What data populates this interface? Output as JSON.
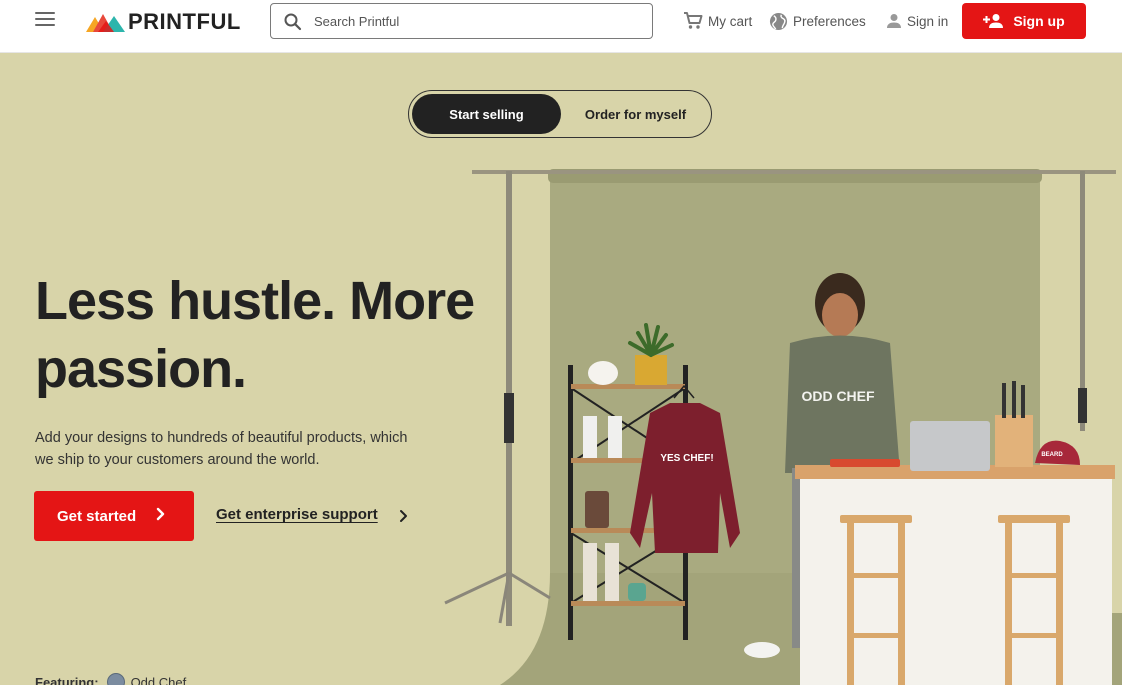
{
  "header": {
    "logo_text": "PRINTFUL",
    "search_placeholder": "Search Printful",
    "cart_label": "My cart",
    "preferences_label": "Preferences",
    "signin_label": "Sign in",
    "signup_label": "Sign up"
  },
  "hero": {
    "toggle": {
      "active_label": "Start selling",
      "inactive_label": "Order for myself"
    },
    "headline": "Less hustle. More passion.",
    "subtext": "Add your designs to hundreds of beautiful products, which we ship to your customers around the world.",
    "primary_cta": "Get started",
    "secondary_cta": "Get enterprise support",
    "featuring_label": "Featuring:",
    "featuring_brand": "Odd Chef",
    "photo": {
      "sweatshirt_text": "YES CHEF!",
      "tshirt_text": "ODD CHEF",
      "cap_text": "BEARD"
    }
  },
  "colors": {
    "brand_red": "#e41515",
    "hero_bg": "#d8d4a9",
    "backdrop": "#a9aa80",
    "dark": "#222222"
  }
}
